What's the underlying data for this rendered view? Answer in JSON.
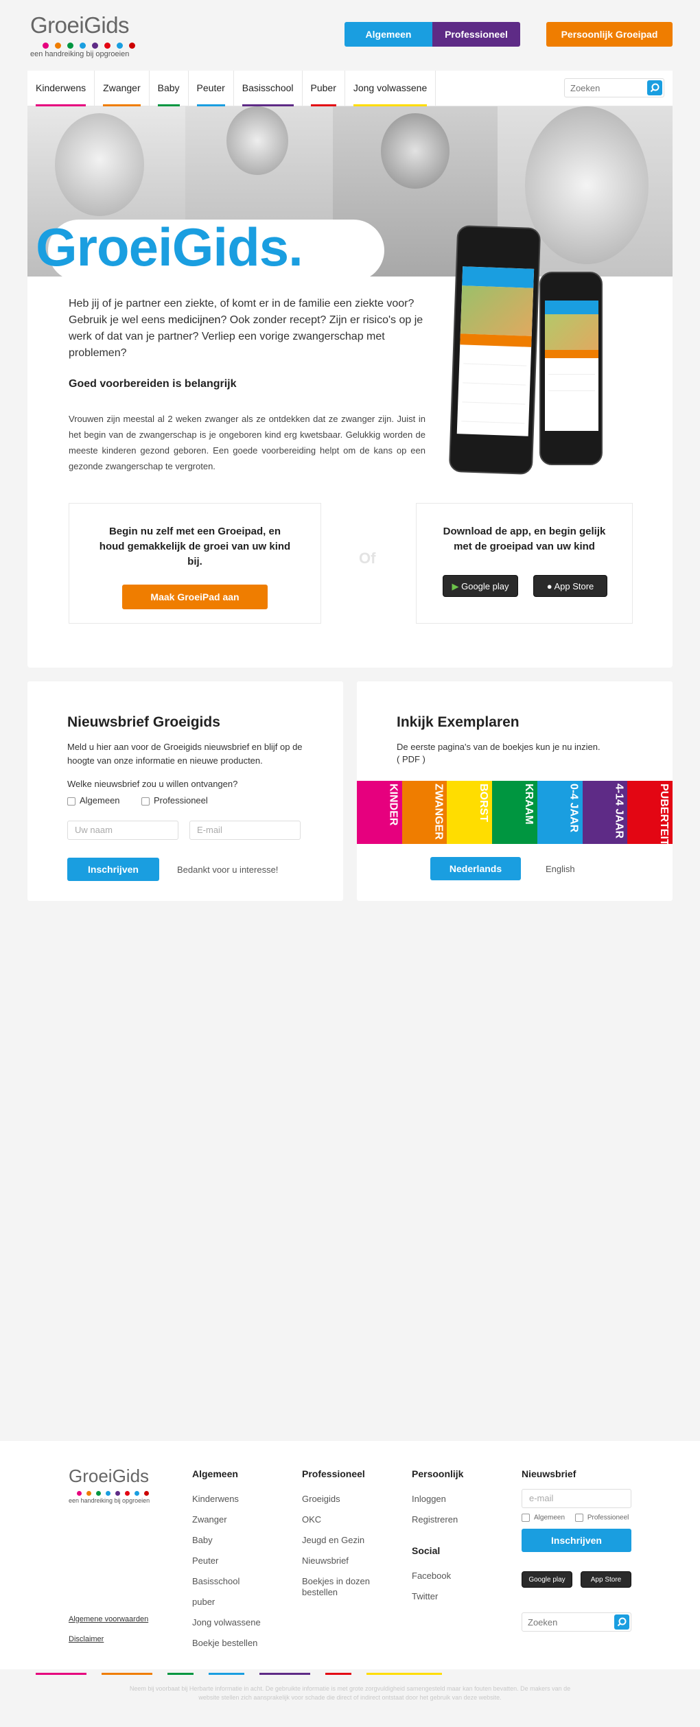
{
  "header": {
    "logo_text": "GroeiGids",
    "logo_tagline": "een handreiking bij opgroeien",
    "logo_dot_colors": [
      "#e6007e",
      "#ef7d00",
      "#009640",
      "#1a9ee0",
      "#5e2b86",
      "#e30613",
      "#1a9ee0",
      "#c00"
    ],
    "btn_algemeen": "Algemeen",
    "btn_professioneel": "Professioneel",
    "btn_persoonlijk": "Persoonlijk Groeipad"
  },
  "nav": {
    "items": [
      {
        "label": "Kinderwens",
        "color": "#e6007e"
      },
      {
        "label": "Zwanger",
        "color": "#ef7d00"
      },
      {
        "label": "Baby",
        "color": "#009640"
      },
      {
        "label": "Peuter",
        "color": "#1a9ee0"
      },
      {
        "label": "Basisschool",
        "color": "#5e2b86"
      },
      {
        "label": "Puber",
        "color": "#e30613"
      },
      {
        "label": "Jong volwassene",
        "color": "#ffdd00"
      }
    ],
    "search_placeholder": "Zoeken"
  },
  "hero": {
    "title": "GroeiGids."
  },
  "main": {
    "intro_pre": "Heb jij of je partner een ziekte, of komt er in de familie een ziekte voor? Gebruik je wel eens ",
    "intro_link": "medicijnen",
    "intro_post": "? Ook zonder recept? Zijn er risico's op je werk of dat van je partner? Verliep een vorige zwangerschap met problemen?",
    "subheading": "Goed voorbereiden is belangrijk",
    "body": "Vrouwen zijn meestal al 2 weken zwanger als ze ontdekken dat ze zwanger zijn. Juist in het begin van de zwangerschap is je ongeboren kind erg kwetsbaar. Gelukkig worden de meeste kinderen gezond geboren. Een goede voorbereiding helpt om de kans op een gezonde zwangerschap te vergroten.",
    "cta_left_title": "Begin nu zelf met een Groeipad, en houd gemakkelijk de groei van uw kind bij.",
    "cta_left_button": "Maak GroeiPad aan",
    "or_text": "Of",
    "cta_right_title": "Download de app, en begin gelijk met de groeipad van uw kind",
    "google_play": "Google play",
    "app_store": "App Store"
  },
  "newsletter": {
    "title": "Nieuwsbrief Groeigids",
    "desc": "Meld u hier aan voor de Groeigids nieuwsbrief en blijf op de hoogte van onze informatie en nieuwe producten.",
    "question": "Welke nieuwsbrief zou u willen ontvangen?",
    "opt_algemeen": "Algemeen",
    "opt_professioneel": "Professioneel",
    "name_placeholder": "Uw naam",
    "email_placeholder": "E-mail",
    "submit": "Inschrijven",
    "thanks": "Bedankt voor u interesse!"
  },
  "inkijk": {
    "title": "Inkijk Exemplaren",
    "desc": "De eerste pagina's van de boekjes kun je nu inzien.",
    "pdf": "( PDF )",
    "books": [
      {
        "label": "KINDER",
        "color": "#e6007e"
      },
      {
        "label": "ZWANGER",
        "color": "#ef7d00"
      },
      {
        "label": "BORST",
        "color": "#ffdd00"
      },
      {
        "label": "KRAAM",
        "color": "#009640"
      },
      {
        "label": "0-4 JAAR",
        "color": "#1a9ee0"
      },
      {
        "label": "4-14 JAAR",
        "color": "#5e2b86"
      },
      {
        "label": "PUBERTEIT",
        "color": "#e30613"
      }
    ],
    "btn_nl": "Nederlands",
    "btn_en": "English"
  },
  "footer": {
    "logo_text": "GroeiGids",
    "logo_tagline": "een handreiking bij opgroeien",
    "link_voorwaarden": "Algemene voorwaarden",
    "link_disclaimer": "Disclaimer",
    "col_algemeen": {
      "title": "Algemeen",
      "links": [
        "Kinderwens",
        "Zwanger",
        "Baby",
        "Peuter",
        "Basisschool",
        "puber",
        "Jong volwassene",
        "Boekje bestellen"
      ]
    },
    "col_professioneel": {
      "title": "Professioneel",
      "links": [
        "Groeigids",
        "OKC",
        "Jeugd en Gezin",
        "Nieuwsbrief",
        "Boekjes in dozen bestellen"
      ]
    },
    "col_persoonlijk": {
      "title": "Persoonlijk",
      "links": [
        "Inloggen",
        "Registreren"
      ]
    },
    "col_social": {
      "title": "Social",
      "links": [
        "Facebook",
        "Twitter"
      ]
    },
    "col_nieuwsbrief": {
      "title": "Nieuwsbrief",
      "email_placeholder": "e-mail",
      "opt_algemeen": "Algemeen",
      "opt_professioneel": "Professioneel",
      "submit": "Inschrijven",
      "google_play": "Google play",
      "app_store": "App Store",
      "search_placeholder": "Zoeken"
    },
    "disclaimer": "Neem bij voorbaat bij Herbarte informatie in acht. De gebruikte informatie is met grote zorgvuldigheid samengesteld maar kan fouten bevatten. De makers van de website stellen zich aansprakelijk voor schade die direct of indirect ontstaat door het gebruik van deze website."
  }
}
